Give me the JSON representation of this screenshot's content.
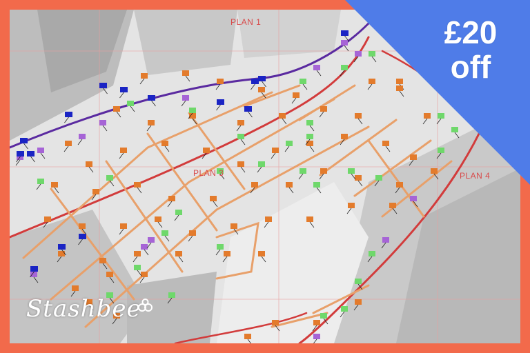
{
  "map": {
    "plan_labels": [
      "PLAN 1",
      "PLAN 3",
      "PLAN 4"
    ]
  },
  "promo": {
    "amount": "£20",
    "suffix": "off",
    "badge_color": "#4f7ce8"
  },
  "brand": {
    "logo_text": "Stashbee",
    "frame_color": "#f26a4b"
  },
  "markers": {
    "orange": "#e37b2c",
    "green": "#6fd86b",
    "purple": "#a664d6",
    "blue": "#1a24c4"
  }
}
